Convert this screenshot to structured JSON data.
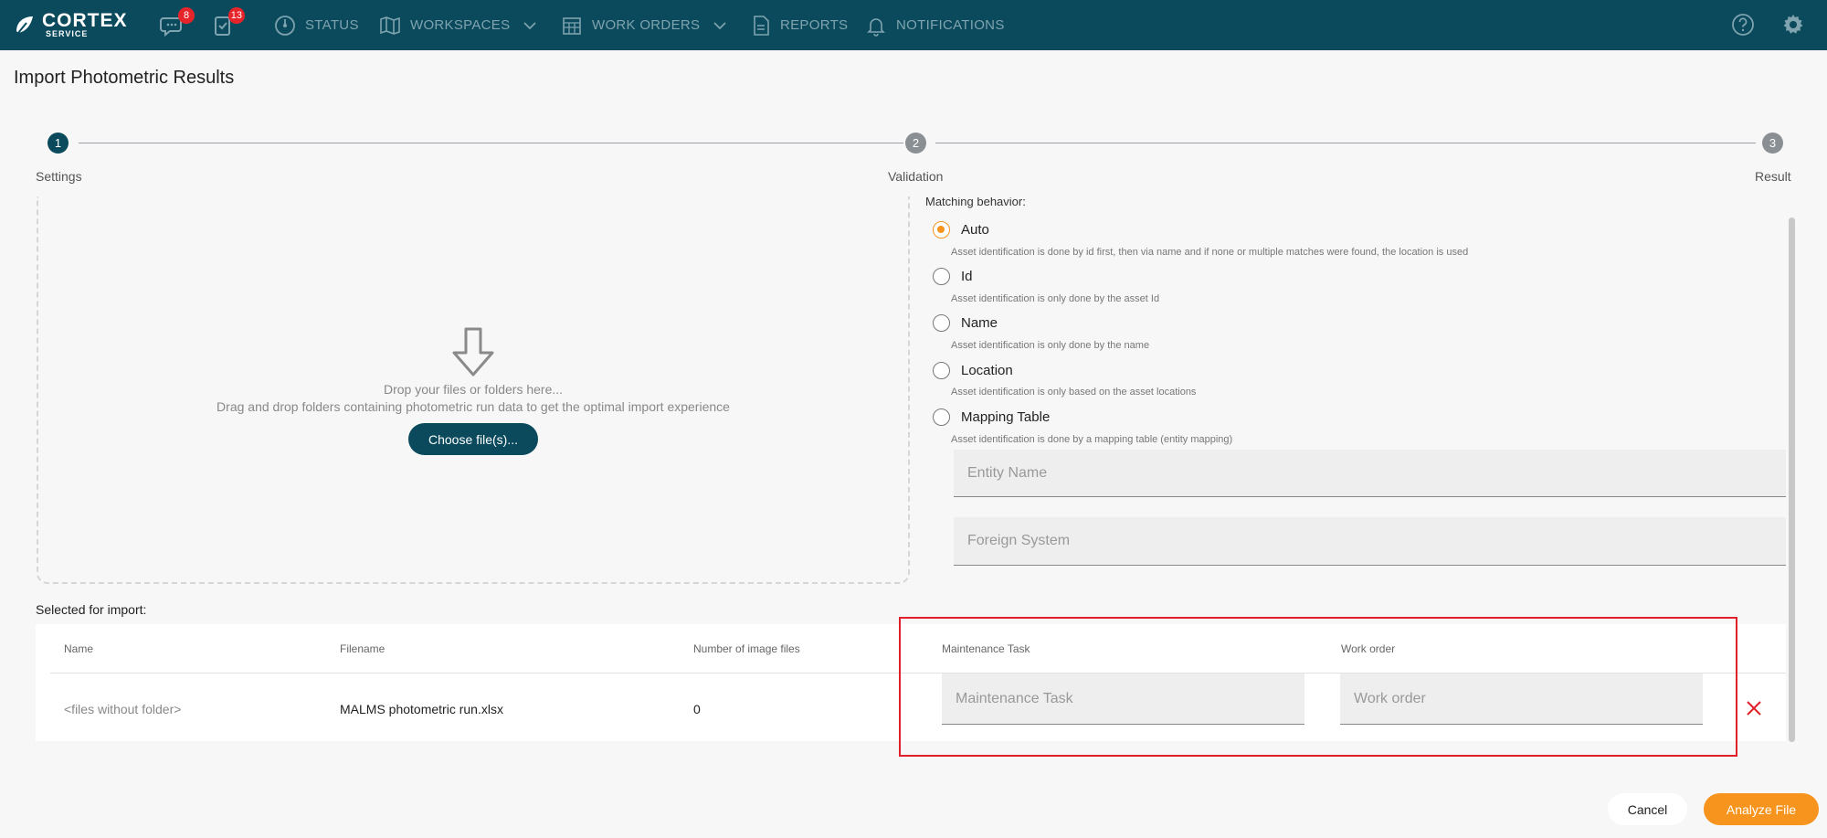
{
  "app": {
    "logo_main": "CORTEX",
    "logo_sub": "SERVICE"
  },
  "header": {
    "chat_badge": "8",
    "tasks_badge": "13",
    "nav": [
      {
        "label": "STATUS",
        "icon": "gauge-icon"
      },
      {
        "label": "WORKSPACES",
        "icon": "map-icon",
        "dropdown": true
      },
      {
        "label": "WORK ORDERS",
        "icon": "calendar-icon",
        "dropdown": true
      },
      {
        "label": "REPORTS",
        "icon": "document-icon"
      },
      {
        "label": "NOTIFICATIONS",
        "icon": "bell-icon"
      }
    ],
    "help_icon": "help-icon",
    "settings_icon": "gear-icon"
  },
  "page": {
    "title": "Import Photometric Results"
  },
  "stepper": {
    "steps": [
      {
        "number": "1",
        "label": "Settings",
        "active": true
      },
      {
        "number": "2",
        "label": "Validation",
        "active": false
      },
      {
        "number": "3",
        "label": "Result",
        "active": false
      }
    ]
  },
  "dropzone": {
    "line1": "Drop your files or folders here...",
    "line2": "Drag and drop folders containing photometric run data to get the optimal import experience",
    "button": "Choose file(s)..."
  },
  "matching": {
    "label": "Matching behavior:",
    "selected": "Auto",
    "options": [
      {
        "label": "Auto",
        "description": "Asset identification is done by id first, then via name and if none or multiple matches were found, the location is used"
      },
      {
        "label": "Id",
        "description": "Asset identification is only done by the asset Id"
      },
      {
        "label": "Name",
        "description": "Asset identification is only done by the name"
      },
      {
        "label": "Location",
        "description": "Asset identification is only based on the asset locations"
      },
      {
        "label": "Mapping Table",
        "description": "Asset identification is done by a mapping table (entity mapping)"
      }
    ],
    "entity_name_placeholder": "Entity Name",
    "foreign_system_placeholder": "Foreign System"
  },
  "import_table": {
    "label": "Selected for import:",
    "columns": [
      "Name",
      "Filename",
      "Number of image files",
      "Maintenance Task",
      "Work order"
    ],
    "rows": [
      {
        "name": "<files without folder>",
        "filename": "MALMS photometric run.xlsx",
        "image_count": "0",
        "maintenance_task_placeholder": "Maintenance Task",
        "work_order_placeholder": "Work order"
      }
    ]
  },
  "footer": {
    "cancel": "Cancel",
    "analyze": "Analyze File"
  },
  "colors": {
    "nav_bg": "#0a4a5c",
    "accent": "#f7941d",
    "highlight": "#e0202a",
    "badge": "#e8242b"
  }
}
